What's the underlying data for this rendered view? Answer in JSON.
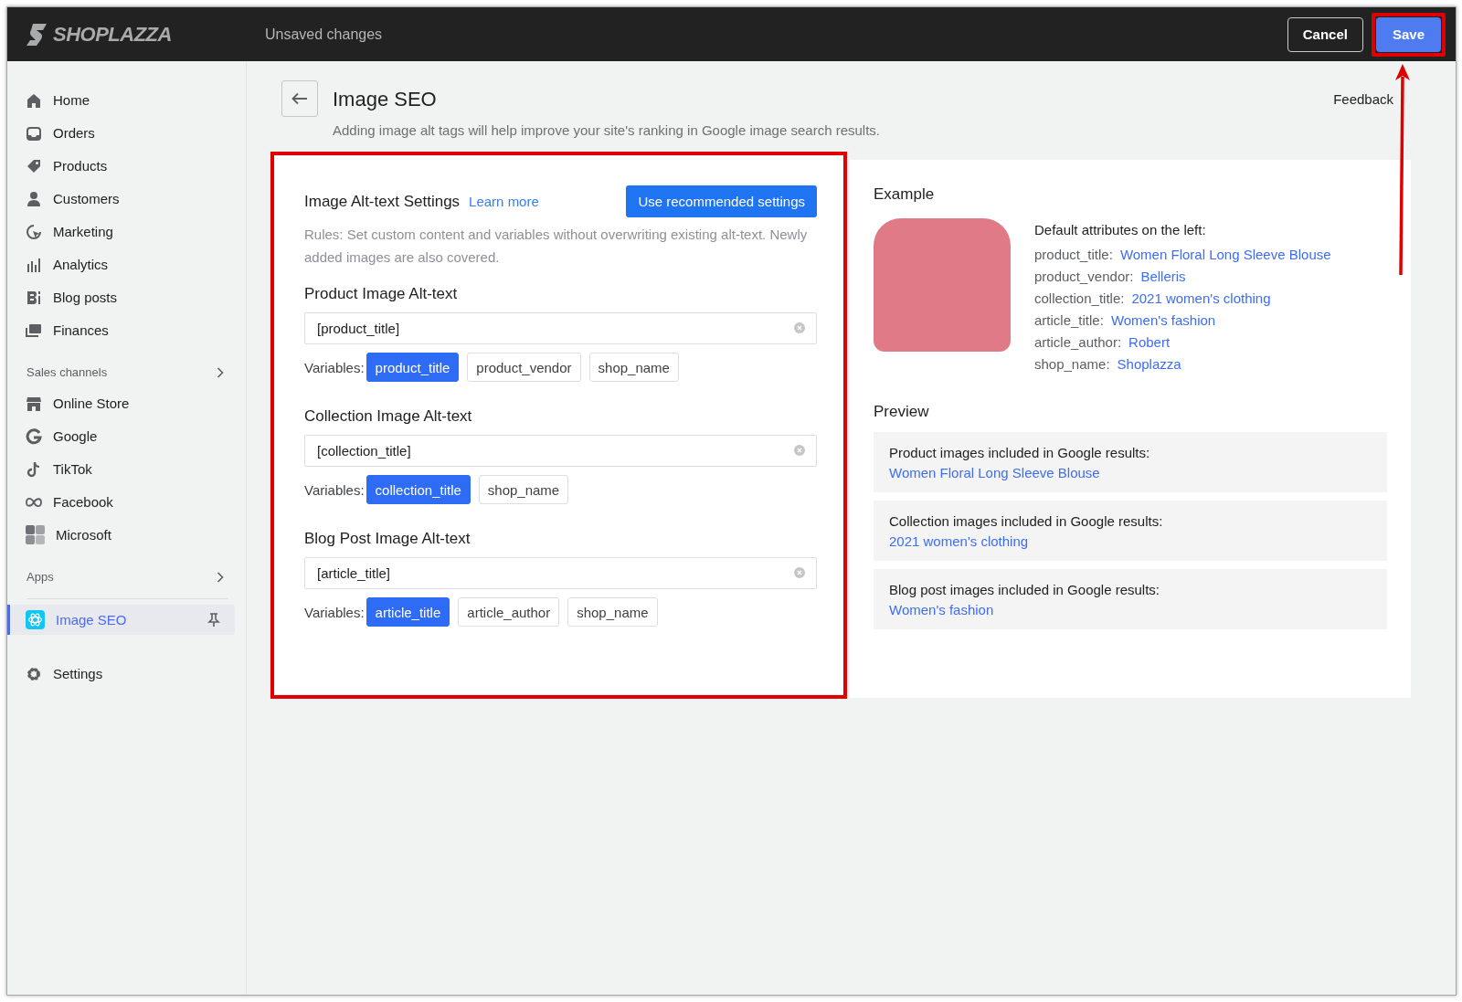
{
  "topbar": {
    "brand": "SHOPLAZZA",
    "status": "Unsaved changes",
    "buttons": [
      {
        "label": "Cancel",
        "kind": "secondary"
      },
      {
        "label": "Save",
        "kind": "primary"
      }
    ]
  },
  "sidebar": {
    "items": [
      {
        "label": "Home",
        "selected": false
      },
      {
        "label": "Orders",
        "selected": false
      },
      {
        "label": "Products",
        "selected": false
      },
      {
        "label": "Customers",
        "selected": false
      },
      {
        "label": "Marketing",
        "selected": false
      },
      {
        "label": "Analytics",
        "selected": false
      },
      {
        "label": "Blog posts",
        "selected": false
      },
      {
        "label": "Finances",
        "selected": false
      }
    ],
    "sections": [
      {
        "title": "Sales channels",
        "items": [
          {
            "label": "Online Store",
            "selected": false
          },
          {
            "label": "Google",
            "selected": false
          },
          {
            "label": "TikTok",
            "selected": false
          },
          {
            "label": "Facebook",
            "selected": false
          },
          {
            "label": "Microsoft",
            "selected": false
          }
        ]
      },
      {
        "title": "Apps",
        "items": [
          {
            "label": "Image SEO",
            "selected": true,
            "pinned": true
          }
        ]
      }
    ],
    "footer_items": [
      {
        "label": "Settings",
        "selected": false
      }
    ]
  },
  "page": {
    "title": "Image SEO",
    "subtitle": "Adding image alt tags will help improve your site's ranking in Google image search results.",
    "feedback": "Feedback"
  },
  "settings": {
    "title": "Image Alt-text Settings",
    "link": "Learn more",
    "button": "Use recommended settings",
    "rules": "Rules: Set custom content and variables without overwriting existing alt-text. Newly added images are also covered.",
    "groups": [
      {
        "heading": "Product Image Alt-text",
        "value": "[product_title]",
        "variables_label": "Variables:",
        "variables": [
          {
            "label": "product_title",
            "selected": true
          },
          {
            "label": "product_vendor",
            "selected": false
          },
          {
            "label": "shop_name",
            "selected": false
          }
        ]
      },
      {
        "heading": "Collection Image Alt-text",
        "value": "[collection_title]",
        "variables_label": "Variables:",
        "variables": [
          {
            "label": "collection_title",
            "selected": true
          },
          {
            "label": "shop_name",
            "selected": false
          }
        ]
      },
      {
        "heading": "Blog Post Image Alt-text",
        "value": "[article_title]",
        "variables_label": "Variables:",
        "variables": [
          {
            "label": "article_title",
            "selected": true
          },
          {
            "label": "article_author",
            "selected": false
          },
          {
            "label": "shop_name",
            "selected": false
          }
        ]
      }
    ]
  },
  "example": {
    "title": "Example",
    "attributes_title": "Default attributes on the left:",
    "attributes": [
      {
        "key": "product_title:",
        "value": "Women Floral Long Sleeve Blouse"
      },
      {
        "key": "product_vendor:",
        "value": "Belleris"
      },
      {
        "key": "collection_title:",
        "value": "2021 women's clothing"
      },
      {
        "key": "article_title:",
        "value": "Women's fashion"
      },
      {
        "key": "article_author:",
        "value": "Robert"
      },
      {
        "key": "shop_name:",
        "value": "Shoplazza"
      }
    ],
    "preview_title": "Preview",
    "previews": [
      {
        "label": "Product images included in Google results:",
        "value": "Women Floral Long Sleeve Blouse"
      },
      {
        "label": "Collection images included in Google results:",
        "value": "2021 women's clothing"
      },
      {
        "label": "Blog post images included in Google results:",
        "value": "Women's fashion"
      }
    ]
  }
}
